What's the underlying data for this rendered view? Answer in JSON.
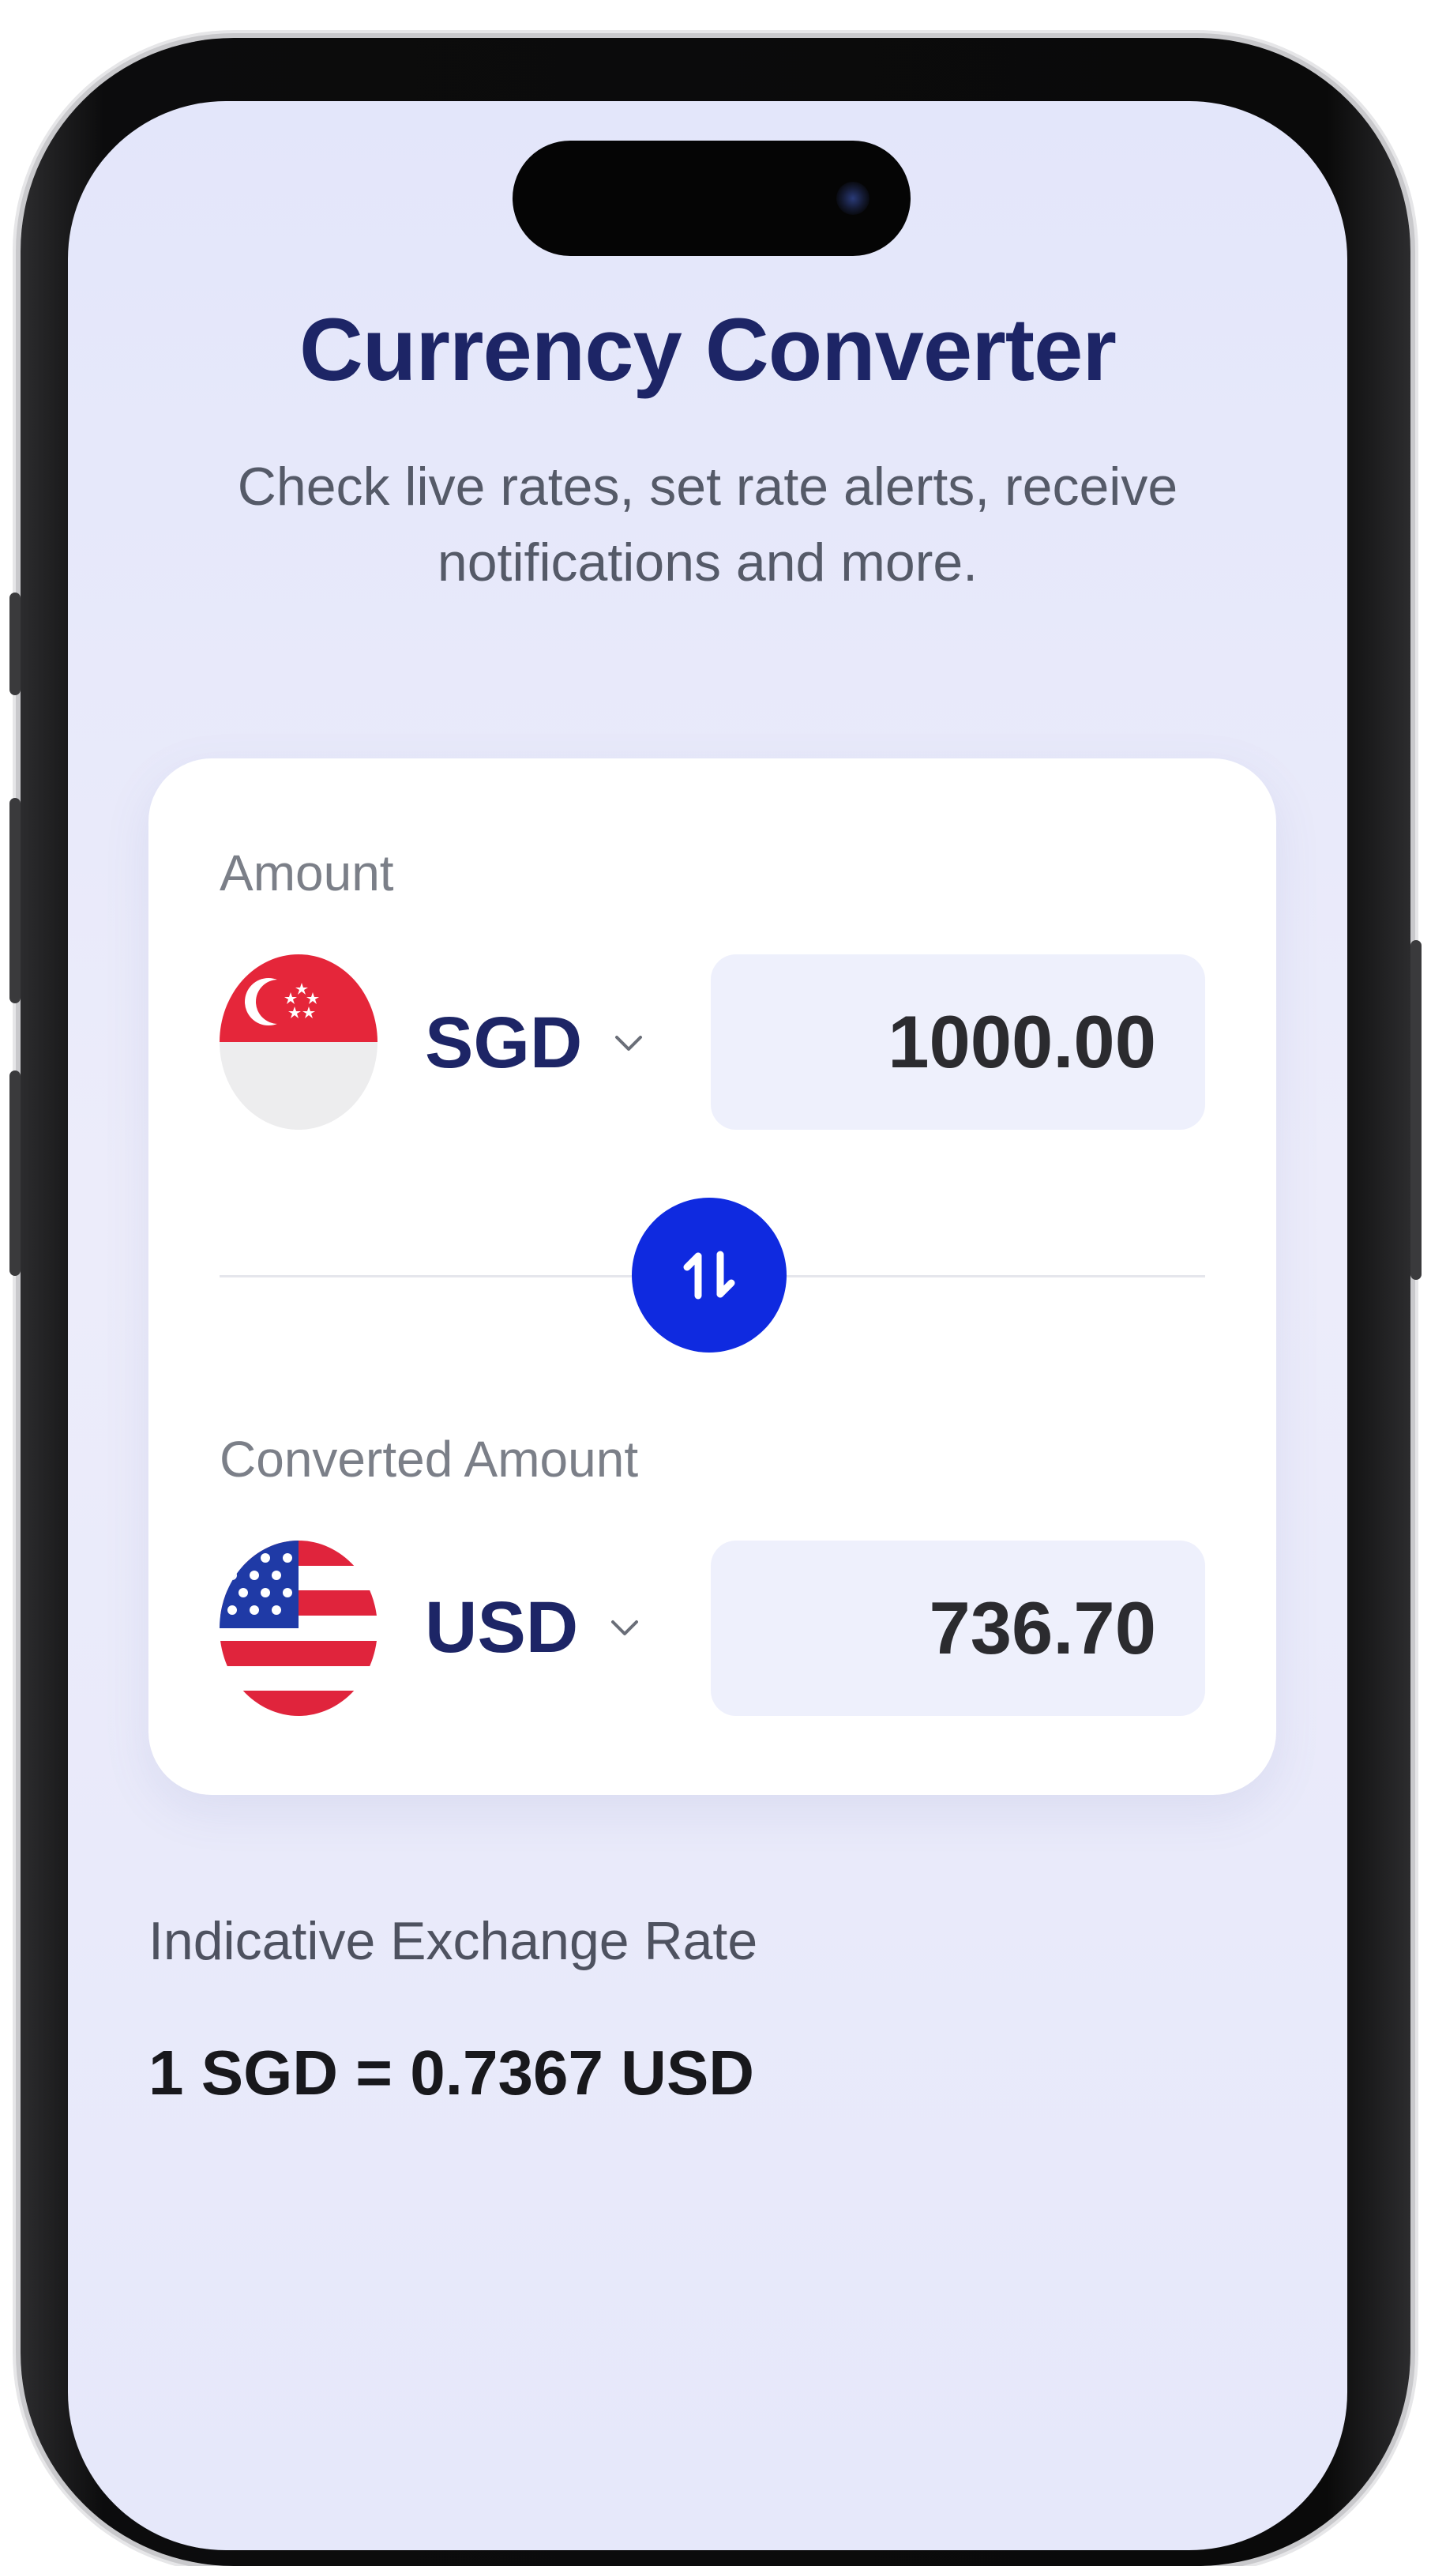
{
  "header": {
    "title": "Currency Converter",
    "subtitle": "Check live rates, set rate alerts, receive notifications and more."
  },
  "converter": {
    "amount_label": "Amount",
    "converted_label": "Converted Amount",
    "from": {
      "currency": "SGD",
      "flag_icon": "singapore-flag-icon",
      "value": "1000.00"
    },
    "to": {
      "currency": "USD",
      "flag_icon": "united-states-flag-icon",
      "value": "736.70"
    },
    "swap_icon": "swap-vertical-icon"
  },
  "rate": {
    "label": "Indicative Exchange Rate",
    "value": "1 SGD = 0.7367 USD"
  },
  "colors": {
    "primary_text": "#1d2566",
    "accent_button": "#0f2ae0",
    "background": "#e6e8fa"
  }
}
